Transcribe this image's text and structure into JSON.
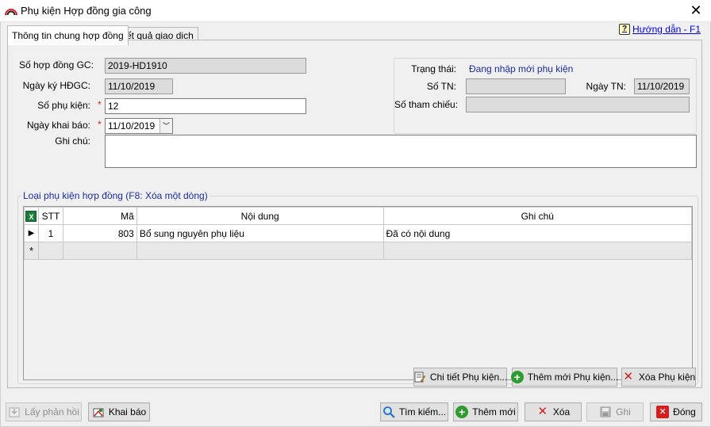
{
  "window": {
    "title": "Phụ kiện Hợp đồng gia công"
  },
  "tabs": [
    {
      "label": "Thông tin chung hợp đồng"
    },
    {
      "label": "Kết quả giao dịch"
    }
  ],
  "help": {
    "label": "Hướng dẫn - F1"
  },
  "form": {
    "so_hop_dong_label": "Số hợp đồng GC:",
    "so_hop_dong_value": "2019-HD1910",
    "ngay_ky_label": "Ngày ký HĐGC:",
    "ngay_ky_value": "11/10/2019",
    "so_phu_kien_label": "Số phụ kiện:",
    "so_phu_kien_value": "12",
    "ngay_khai_bao_label": "Ngày khai báo:",
    "ngay_khai_bao_value": "11/10/2019",
    "ghi_chu_label": "Ghi chú:",
    "ghi_chu_value": "",
    "required_mark": "*"
  },
  "status": {
    "trang_thai_label": "Trạng thái:",
    "trang_thai_value": "Đang nhập mới phụ kiện",
    "so_tn_label": "Số TN:",
    "so_tn_value": "",
    "ngay_tn_label": "Ngày TN:",
    "ngay_tn_value": "11/10/2019",
    "so_tham_chieu_label": "Số tham chiếu:",
    "so_tham_chieu_value": ""
  },
  "grid": {
    "title": "Loại phụ kiện hợp đồng (F8: Xóa một dòng)",
    "columns": [
      "STT",
      "Mã",
      "Nội dung",
      "Ghi chú"
    ],
    "rows": [
      {
        "stt": "1",
        "ma": "803",
        "noi_dung": "Bổ sung nguyên phụ liệu",
        "ghi_chu": "Đã có nội dung"
      }
    ],
    "current_row_marker": "▶",
    "new_row_marker": "*"
  },
  "grid_buttons": {
    "chi_tiet": "Chi tiết Phụ kiện...",
    "them_moi_pk": "Thêm mới Phụ kiện...",
    "xoa_pk": "Xóa Phụ kiện"
  },
  "bottom_buttons": {
    "lay_phan_hoi": "Lấy phản hồi",
    "khai_bao": "Khai báo",
    "tim_kiem": "Tìm kiếm...",
    "them_moi": "Thêm mới",
    "xoa": "Xóa",
    "ghi": "Ghi",
    "dong": "Đóng"
  },
  "colors": {
    "accent_text": "#1a2aa6",
    "required": "#e02020",
    "link": "#0000ee"
  }
}
